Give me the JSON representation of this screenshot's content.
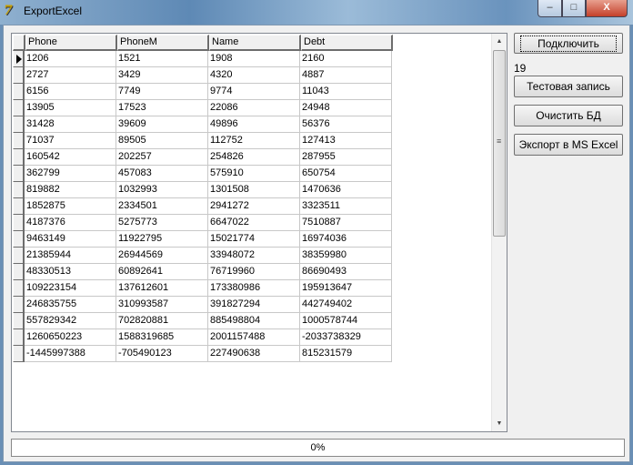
{
  "window": {
    "title": "ExportExcel",
    "minimize": "–",
    "maximize": "□",
    "close": "X"
  },
  "grid": {
    "columns": [
      "Phone",
      "PhoneM",
      "Name",
      "Debt"
    ],
    "rows": [
      [
        "1206",
        "1521",
        "1908",
        "2160"
      ],
      [
        "2727",
        "3429",
        "4320",
        "4887"
      ],
      [
        "6156",
        "7749",
        "9774",
        "11043"
      ],
      [
        "13905",
        "17523",
        "22086",
        "24948"
      ],
      [
        "31428",
        "39609",
        "49896",
        "56376"
      ],
      [
        "71037",
        "89505",
        "112752",
        "127413"
      ],
      [
        "160542",
        "202257",
        "254826",
        "287955"
      ],
      [
        "362799",
        "457083",
        "575910",
        "650754"
      ],
      [
        "819882",
        "1032993",
        "1301508",
        "1470636"
      ],
      [
        "1852875",
        "2334501",
        "2941272",
        "3323511"
      ],
      [
        "4187376",
        "5275773",
        "6647022",
        "7510887"
      ],
      [
        "9463149",
        "11922795",
        "15021774",
        "16974036"
      ],
      [
        "21385944",
        "26944569",
        "33948072",
        "38359980"
      ],
      [
        "48330513",
        "60892641",
        "76719960",
        "86690493"
      ],
      [
        "109223154",
        "137612601",
        "173380986",
        "195913647"
      ],
      [
        "246835755",
        "310993587",
        "391827294",
        "442749402"
      ],
      [
        "557829342",
        "702820881",
        "885498804",
        "1000578744"
      ],
      [
        "1260650223",
        "1588319685",
        "2001157488",
        "-2033738329"
      ],
      [
        "-1445997388",
        "-705490123",
        "227490638",
        "815231579"
      ]
    ],
    "current_row": 0
  },
  "buttons": {
    "connect": "Подключить",
    "test": "Тестовая запись",
    "clear": "Очистить БД",
    "export": "Экспорт в MS Excel"
  },
  "count_label": "19",
  "progress": {
    "text": "0%",
    "value": 0
  }
}
